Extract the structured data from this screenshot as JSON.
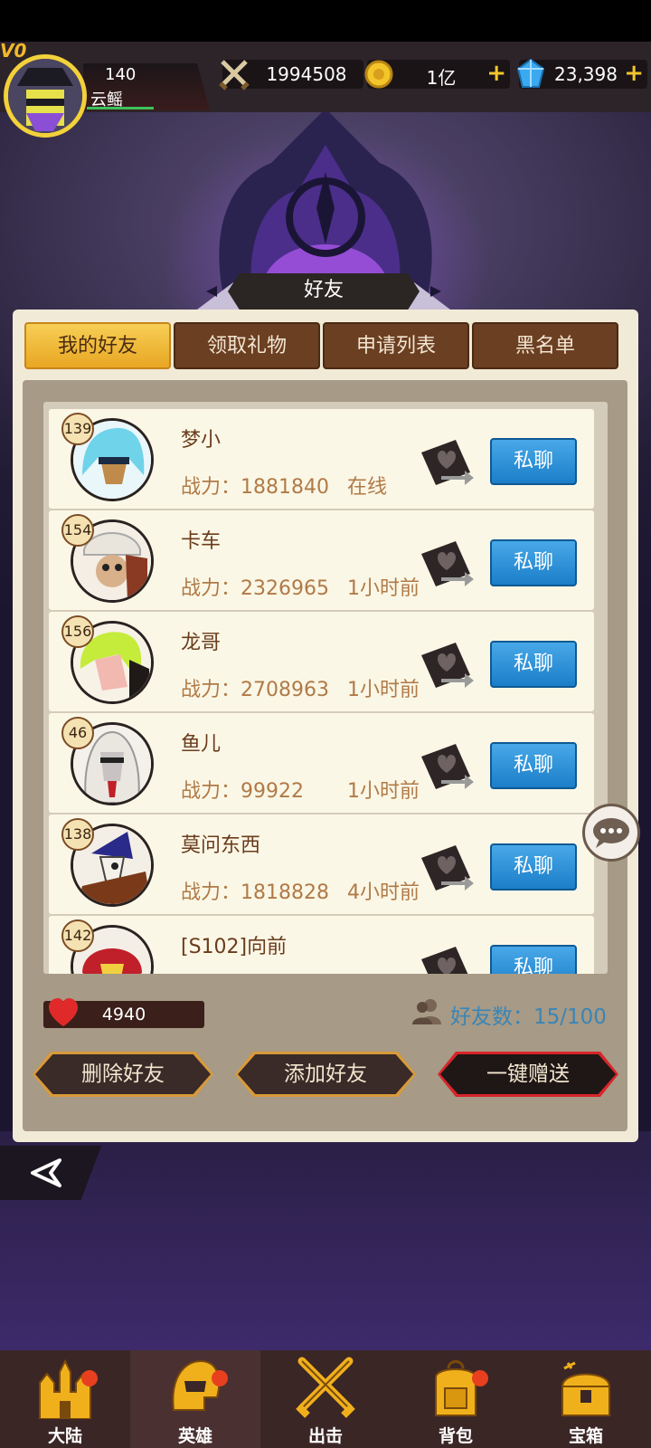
{
  "player": {
    "vip": "V0",
    "level": "140",
    "name": "云鳐"
  },
  "resources": {
    "power": "1994508",
    "gold": "1亿",
    "gems": "23,398"
  },
  "panel": {
    "title": "好友",
    "tabs": [
      "我的好友",
      "领取礼物",
      "申请列表",
      "黑名单"
    ],
    "active_tab": "我的好友"
  },
  "friends": [
    {
      "level": "139",
      "name": "梦小",
      "power": "战力：1881840",
      "status": "在线",
      "chat": "私聊"
    },
    {
      "level": "154",
      "name": "卡车",
      "power": "战力：2326965",
      "status": "1小时前",
      "chat": "私聊"
    },
    {
      "level": "156",
      "name": "龙哥",
      "power": "战力：2708963",
      "status": "1小时前",
      "chat": "私聊"
    },
    {
      "level": "46",
      "name": "鱼儿",
      "power": "战力：99922",
      "status": "1小时前",
      "chat": "私聊"
    },
    {
      "level": "138",
      "name": "莫问东西",
      "power": "战力：1818828",
      "status": "4小时前",
      "chat": "私聊"
    },
    {
      "level": "142",
      "name": "[S102]向前",
      "power": "",
      "status": "",
      "chat": "私聊"
    }
  ],
  "footer": {
    "stamina": "4940",
    "friend_count": "好友数：15/100",
    "delete_button": "删除好友",
    "add_button": "添加好友",
    "gift_all_button": "一键赠送"
  },
  "nav": [
    {
      "label": "大陆",
      "icon": "castle-icon",
      "badge": true
    },
    {
      "label": "英雄",
      "icon": "helmet-icon",
      "badge": true
    },
    {
      "label": "出击",
      "icon": "crossed-swords-icon",
      "badge": false
    },
    {
      "label": "背包",
      "icon": "backpack-icon",
      "badge": true
    },
    {
      "label": "宝箱",
      "icon": "treasure-chest-icon",
      "badge": false
    }
  ],
  "colors": {
    "accent_gold": "#f3c52a",
    "chat_blue": "#1b7ec8",
    "tab_brown": "#6b3f21",
    "badge_red": "#e8401f"
  }
}
